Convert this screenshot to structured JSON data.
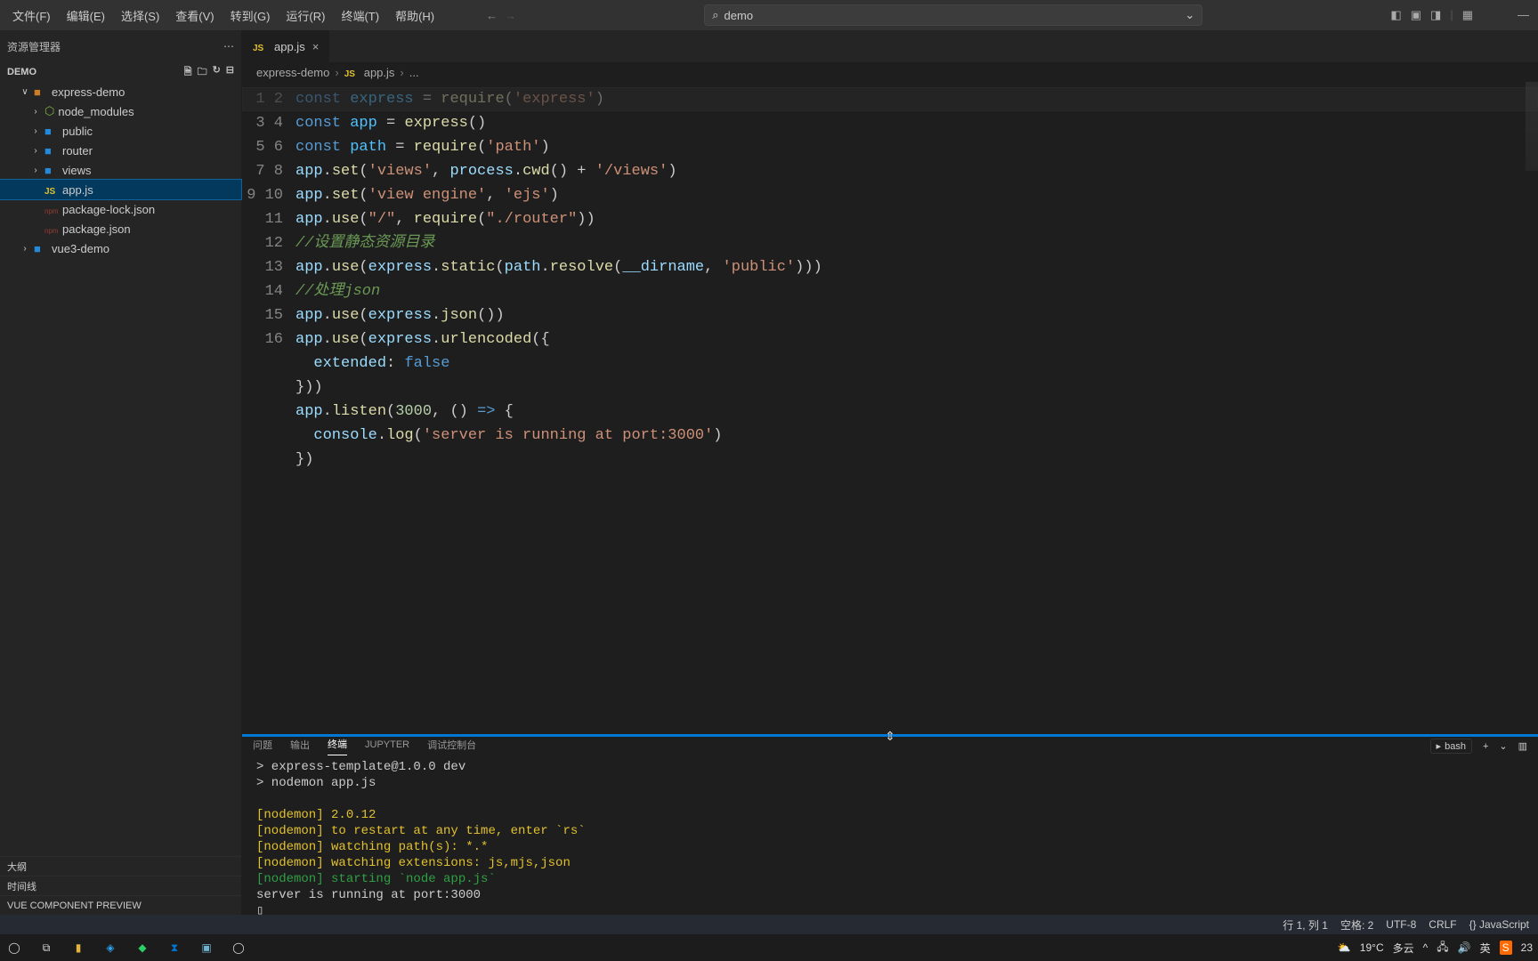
{
  "menu": {
    "file": "文件(F)",
    "edit": "编辑(E)",
    "select": "选择(S)",
    "view": "查看(V)",
    "go": "转到(G)",
    "run": "运行(R)",
    "terminal": "终端(T)",
    "help": "帮助(H)"
  },
  "search": {
    "value": "demo"
  },
  "sidebar": {
    "header": "资源管理器",
    "section": "DEMO",
    "items": [
      {
        "label": "express-demo",
        "icon": "folder-open",
        "chev": "∨"
      },
      {
        "label": "node_modules",
        "icon": "folder",
        "chev": "›"
      },
      {
        "label": "public",
        "icon": "folder",
        "chev": "›"
      },
      {
        "label": "router",
        "icon": "folder",
        "chev": "›"
      },
      {
        "label": "views",
        "icon": "folder",
        "chev": "›"
      },
      {
        "label": "app.js",
        "icon": "js",
        "chev": ""
      },
      {
        "label": "package-lock.json",
        "icon": "json",
        "chev": ""
      },
      {
        "label": "package.json",
        "icon": "json",
        "chev": ""
      },
      {
        "label": "vue3-demo",
        "icon": "folder",
        "chev": "›"
      }
    ],
    "bottom": {
      "outline": "大纲",
      "timeline": "时间线",
      "vue": "VUE COMPONENT PREVIEW"
    }
  },
  "tabs": {
    "active_file": "app.js"
  },
  "breadcrumb": {
    "folder": "express-demo",
    "file": "app.js",
    "tail": "..."
  },
  "code": {
    "lines": [
      1,
      2,
      3,
      4,
      5,
      6,
      7,
      8,
      9,
      10,
      11,
      12,
      13,
      14,
      15,
      16
    ]
  },
  "panel": {
    "tabs": {
      "problems": "问题",
      "output": "输出",
      "terminal": "终端",
      "jupyter": "JUPYTER",
      "debug": "调试控制台"
    },
    "shell": "bash",
    "term_lines": [
      "> express-template@1.0.0 dev",
      "> nodemon app.js",
      "",
      "[nodemon] 2.0.12",
      "[nodemon] to restart at any time, enter `rs`",
      "[nodemon] watching path(s): *.*",
      "[nodemon] watching extensions: js,mjs,json",
      "[nodemon] starting `node app.js`",
      "server is running at port:3000",
      "▯"
    ]
  },
  "status": {
    "line": "行 1, 列 1",
    "spaces": "空格: 2",
    "enc": "UTF-8",
    "eol": "CRLF",
    "lang": "{} JavaScript"
  },
  "taskbar": {
    "weather_temp": "19°C",
    "weather_text": "多云",
    "time": "23"
  }
}
